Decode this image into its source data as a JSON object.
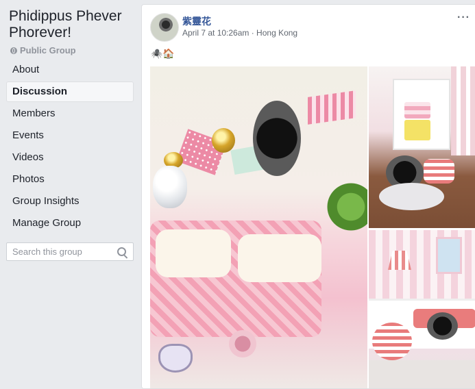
{
  "group": {
    "name": "Phidippus Phever Phorever!",
    "privacy": "Public Group",
    "privacy_icon": "globe-icon"
  },
  "nav": {
    "items": [
      {
        "label": "About",
        "active": false
      },
      {
        "label": "Discussion",
        "active": true
      },
      {
        "label": "Members",
        "active": false
      },
      {
        "label": "Events",
        "active": false
      },
      {
        "label": "Videos",
        "active": false
      },
      {
        "label": "Photos",
        "active": false
      },
      {
        "label": "Group Insights",
        "active": false
      },
      {
        "label": "Manage Group",
        "active": false
      }
    ]
  },
  "search": {
    "placeholder": "Search this group",
    "value": "",
    "icon": "search-icon"
  },
  "post": {
    "author": "紫靈花",
    "meta": "April 7 at 10:26am · Hong Kong",
    "text": "🕷️🏠",
    "more_label": "···",
    "photos": [
      "spider-dollhouse-sofa-photo",
      "spider-dollhouse-nightstand-photo",
      "spider-dollhouse-bed-photo"
    ]
  },
  "colors": {
    "page_bg": "#e9ebee",
    "link_blue": "#365899",
    "muted_text": "#90949c",
    "card_bg": "#ffffff"
  }
}
